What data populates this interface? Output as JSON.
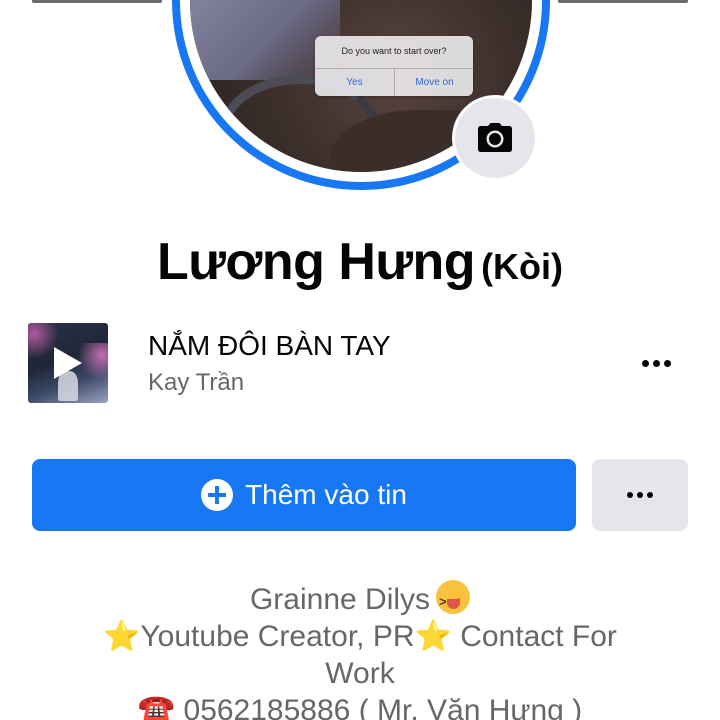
{
  "profile": {
    "name": "Lương Hưng",
    "alternate_name": "(Kòi)"
  },
  "photo_dialog": {
    "question": "Do you want to start over?",
    "yes": "Yes",
    "move_on": "Move on"
  },
  "music": {
    "title": "NẮM ĐÔI BÀN TAY",
    "artist": "Kay Trần",
    "play_icon": "play-icon",
    "more_icon": "more-dots-icon"
  },
  "actions": {
    "add_story_label": "Thêm vào tin",
    "add_story_icon": "plus-circle-icon",
    "more_icon": "more-dots-icon"
  },
  "bio": {
    "line1": "Grainne Dilys",
    "line1_emoji": "😝",
    "line2_star_left": "⭐",
    "line2_text": "Youtube Creator, PR",
    "line2_star_right": "⭐",
    "line2_tail": " Contact For",
    "line3": "Work",
    "line4_emoji": "☎️",
    "line4": " 0562185886 ( Mr. Văn Hưng )"
  },
  "colors": {
    "accent": "#1877f2",
    "secondary_button": "#e4e6eb",
    "secondary_text": "#65676b",
    "primary_text": "#050505"
  }
}
